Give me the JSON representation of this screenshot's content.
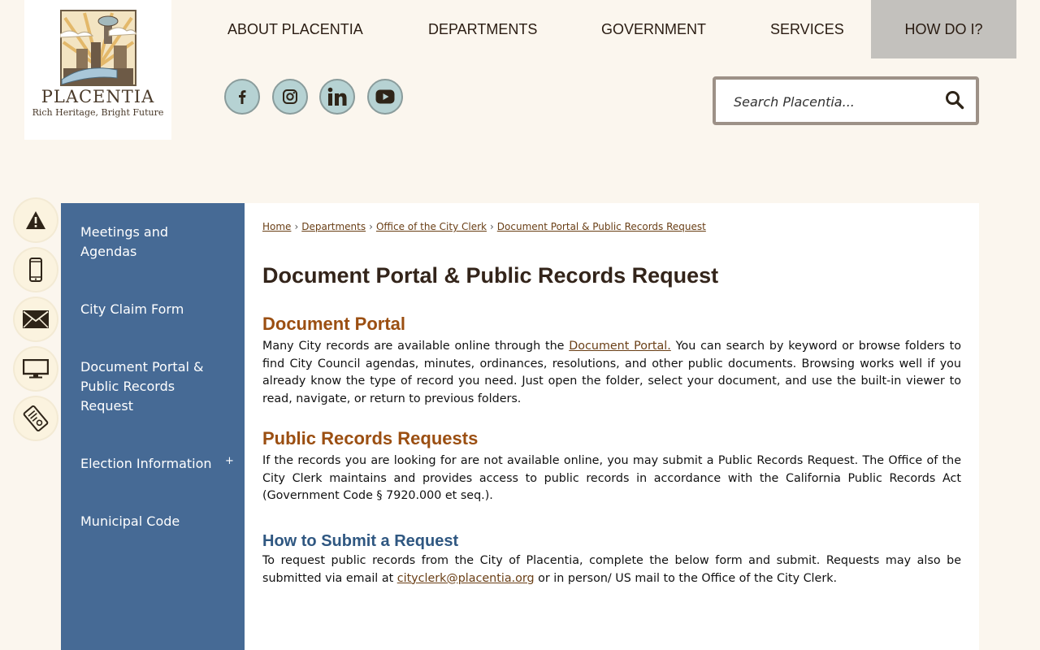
{
  "logo": {
    "name": "PLACENTIA",
    "tagline": "Rich Heritage, Bright Future"
  },
  "nav": [
    {
      "label": "ABOUT PLACENTIA"
    },
    {
      "label": "DEPARTMENTS"
    },
    {
      "label": "GOVERNMENT"
    },
    {
      "label": "SERVICES"
    },
    {
      "label": "HOW DO I?"
    }
  ],
  "social": [
    "facebook-icon",
    "instagram-icon",
    "linkedin-icon",
    "youtube-icon"
  ],
  "search": {
    "placeholder": "Search Placentia..."
  },
  "quick_links": [
    "alert-icon",
    "mobile-phone-icon",
    "envelope-icon",
    "monitor-icon",
    "document-stamp-icon"
  ],
  "sidebar": {
    "items": [
      {
        "label": "Meetings and Agendas"
      },
      {
        "label": "City Claim Form"
      },
      {
        "label": "Document Portal & Public Records Request"
      },
      {
        "label": "Election Information"
      },
      {
        "label": "Municipal Code"
      }
    ],
    "expand_glyph": "+"
  },
  "breadcrumb": [
    "Home",
    "Departments",
    "Office of the City Clerk",
    "Document Portal & Public Records Request"
  ],
  "breadcrumb_sep": "›",
  "page_title": "Document Portal & Public Records Request",
  "sections": {
    "portal": {
      "heading": "Document Portal",
      "text_before": "Many City records are available online through the ",
      "link": "Document Portal.",
      "text_after": " You can search by keyword or browse folders to find City Council agendas, minutes, ordinances, resolutions, and other public documents. Browsing works well if you already know the type of record you need. Just open the folder, select your document, and use the built-in viewer to read, navigate, or return to previous folders."
    },
    "requests": {
      "heading": "Public Records Requests",
      "text": "If the records you are looking for are not available online, you may submit a Public Records Request. The Office of the City Clerk maintains and provides access to public records in accordance with the California Public Records Act (Government Code § 7920.000 et seq.)."
    },
    "howto": {
      "heading": "How to Submit a Request",
      "text_before": "To request public records from the City of Placentia, complete the below form and submit. Requests may also be submitted via email at ",
      "email": "cityclerk@placentia.org",
      "text_after": " or in person/ US mail to the Office of the City Clerk."
    }
  }
}
